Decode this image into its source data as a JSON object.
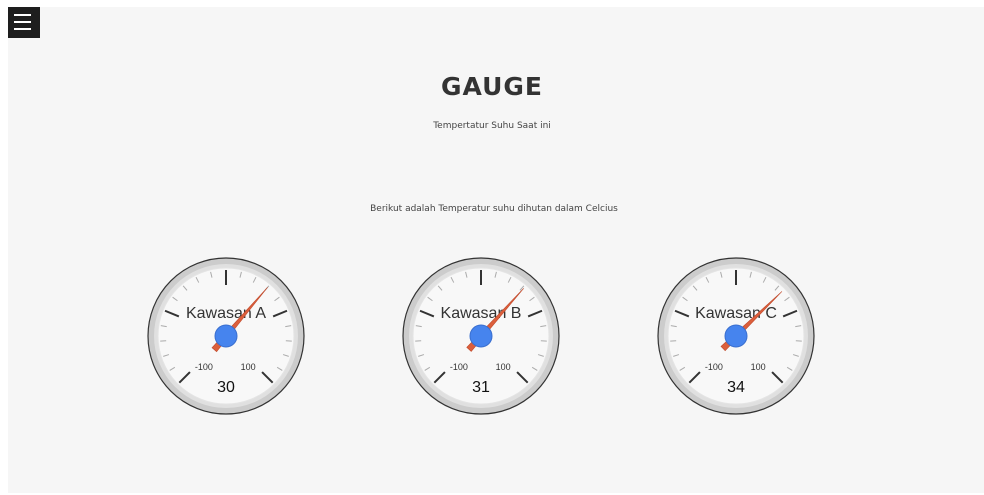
{
  "header": {
    "menu_icon": "hamburger-menu-icon"
  },
  "main": {
    "title": "GAUGE",
    "subtitle": "Tempertatur Suhu Saat ini",
    "description": "Berikut adalah Temperatur suhu dihutan dalam Celcius"
  },
  "gauge_scale": {
    "min": -100,
    "max": 100,
    "min_label": "-100",
    "max_label": "100"
  },
  "gauges": [
    {
      "label": "Kawasan A",
      "value": 30,
      "value_text": "30"
    },
    {
      "label": "Kawasan B",
      "value": 31,
      "value_text": "31"
    },
    {
      "label": "Kawasan C",
      "value": 34,
      "value_text": "34"
    }
  ],
  "colors": {
    "needle": "#dc5f3c",
    "hub": "#4684ee",
    "bezel": "#cccccc",
    "face": "#f8f8f8",
    "page_background": "#f6f6f6"
  }
}
